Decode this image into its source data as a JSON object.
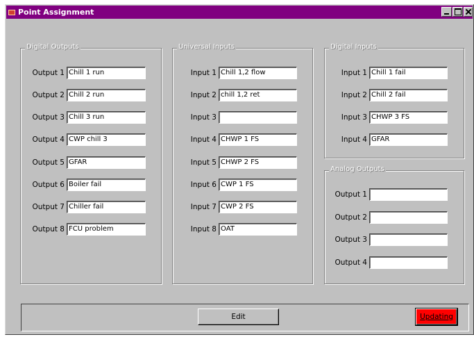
{
  "window": {
    "title": "Point Assignment"
  },
  "digital_outputs": {
    "legend": "Digital Outputs",
    "rows": [
      {
        "label": "Output 1",
        "value": "Chill 1 run"
      },
      {
        "label": "Output 2",
        "value": "Chill 2 run"
      },
      {
        "label": "Output 3",
        "value": "Chill 3 run"
      },
      {
        "label": "Output 4",
        "value": "CWP chill 3"
      },
      {
        "label": "Output 5",
        "value": "GFAR"
      },
      {
        "label": "Output 6",
        "value": "Boiler fail"
      },
      {
        "label": "Output 7",
        "value": "Chiller fail"
      },
      {
        "label": "Output 8",
        "value": "FCU problem"
      }
    ]
  },
  "universal_inputs": {
    "legend": "Universal Inputs",
    "rows": [
      {
        "label": "Input 1",
        "value": "Chill 1,2 flow"
      },
      {
        "label": "Input 2",
        "value": "chill 1,2 ret"
      },
      {
        "label": "Input 3",
        "value": ""
      },
      {
        "label": "Input 4",
        "value": "CHWP 1 FS"
      },
      {
        "label": "Input 5",
        "value": "CHWP 2 FS"
      },
      {
        "label": "Input 6",
        "value": "CWP 1 FS"
      },
      {
        "label": "Input 7",
        "value": "CWP 2 FS"
      },
      {
        "label": "Input 8",
        "value": "OAT"
      }
    ]
  },
  "digital_inputs": {
    "legend": "Digital Inputs",
    "rows": [
      {
        "label": "Input 1",
        "value": "Chill 1 fail"
      },
      {
        "label": "Input 2",
        "value": "Chill 2 fail"
      },
      {
        "label": "Input 3",
        "value": "CHWP 3 FS"
      },
      {
        "label": "Input 4",
        "value": "GFAR"
      }
    ]
  },
  "analog_outputs": {
    "legend": "Analog Outputs",
    "rows": [
      {
        "label": "Output 1",
        "value": ""
      },
      {
        "label": "Output 2",
        "value": ""
      },
      {
        "label": "Output 3",
        "value": ""
      },
      {
        "label": "Output 4",
        "value": ""
      }
    ]
  },
  "footer": {
    "edit_label": "Edit",
    "updating_label": "Updating"
  },
  "colors": {
    "titlebar": "#800080",
    "face": "#c0c0c0",
    "updating_button": "#ff0000"
  }
}
